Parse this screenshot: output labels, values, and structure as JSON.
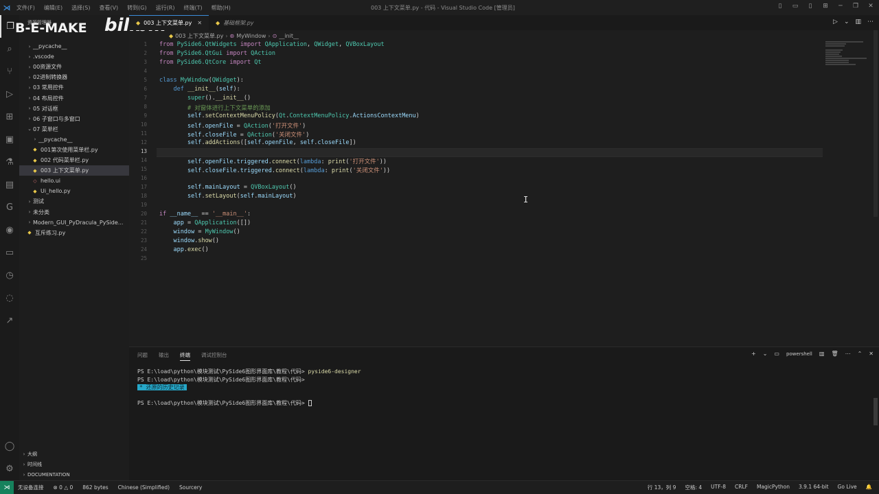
{
  "titlebar": {
    "menu": [
      "文件(F)",
      "编辑(E)",
      "选择(S)",
      "查看(V)",
      "转到(G)",
      "运行(R)",
      "终端(T)",
      "帮助(H)"
    ],
    "window_title": "003 上下文菜单.py - 代码 - Visual Studio Code [管理员]"
  },
  "watermark": {
    "text": "B-E-MAKE",
    "logo": "bilibili"
  },
  "sidebar": {
    "title": "资源管理器",
    "tree": [
      {
        "label": "__pycache__",
        "type": "folder",
        "depth": 1,
        "open": false
      },
      {
        "label": ".vscode",
        "type": "folder",
        "depth": 1,
        "open": false
      },
      {
        "label": "00资源文件",
        "type": "folder",
        "depth": 1,
        "open": false
      },
      {
        "label": "02进制转换器",
        "type": "folder",
        "depth": 1,
        "open": false
      },
      {
        "label": "03 常用控件",
        "type": "folder",
        "depth": 1,
        "open": false
      },
      {
        "label": "04 布局控件",
        "type": "folder",
        "depth": 1,
        "open": false
      },
      {
        "label": "05 对话框",
        "type": "folder",
        "depth": 1,
        "open": false
      },
      {
        "label": "06 子窗口与多窗口",
        "type": "folder",
        "depth": 1,
        "open": false
      },
      {
        "label": "07 菜单栏",
        "type": "folder",
        "depth": 1,
        "open": true
      },
      {
        "label": "__pycache__",
        "type": "folder",
        "depth": 2,
        "open": false
      },
      {
        "label": "001第次使用菜单栏.py",
        "type": "py",
        "depth": 2
      },
      {
        "label": "002 代码菜单栏.py",
        "type": "py",
        "depth": 2
      },
      {
        "label": "003 上下文菜单.py",
        "type": "py",
        "depth": 2,
        "selected": true
      },
      {
        "label": "hello.ui",
        "type": "ui",
        "depth": 2
      },
      {
        "label": "Ui_hello.py",
        "type": "py",
        "depth": 2
      },
      {
        "label": "测试",
        "type": "folder",
        "depth": 1,
        "open": false
      },
      {
        "label": "未分类",
        "type": "folder",
        "depth": 1,
        "open": false
      },
      {
        "label": "Modern_GUI_PyDracula_PySide...",
        "type": "folder",
        "depth": 1,
        "open": false
      },
      {
        "label": "互斥练习.py",
        "type": "py",
        "depth": 1
      }
    ],
    "footer": [
      "大纲",
      "时间线",
      "DOCUMENTATION"
    ]
  },
  "tabs": [
    {
      "label": "003 上下文菜单.py",
      "active": true
    },
    {
      "label": "基础框架.py",
      "active": false,
      "preview": true
    }
  ],
  "breadcrumb": [
    "003 上下文菜单.py",
    "MyWindow",
    "__init__"
  ],
  "editor": {
    "current_line": 13,
    "lines": [
      {
        "n": "1",
        "html": "<span class='k'>from</span> <span class='c'>PySide6.QtWidgets</span> <span class='k'>import</span> <span class='c'>QApplication</span>, <span class='c'>QWidget</span>, <span class='c'>QVBoxLayout</span>"
      },
      {
        "n": "2",
        "html": "<span class='k'>from</span> <span class='c'>PySide6.QtGui</span> <span class='k'>import</span> <span class='c'>QAction</span>"
      },
      {
        "n": "3",
        "html": "<span class='k'>from</span> <span class='c'>PySide6.QtCore</span> <span class='k'>import</span> <span class='c'>Qt</span>"
      },
      {
        "n": "4",
        "html": ""
      },
      {
        "n": "5",
        "html": "<span class='kb'>class</span> <span class='c'>MyWindow</span>(<span class='c'>QWidget</span>):"
      },
      {
        "n": "6",
        "html": "    <span class='kb'>def</span> <span class='f'>__init__</span>(<span class='v'>self</span>):"
      },
      {
        "n": "7",
        "html": "        <span class='c'>super</span>().<span class='f'>__init__</span>()"
      },
      {
        "n": "8",
        "html": "        <span class='cm'># 对窗体进行上下文菜单的添加</span>"
      },
      {
        "n": "9",
        "html": "        <span class='v'>self</span>.<span class='f'>setContextMenuPolicy</span>(<span class='c'>Qt</span>.<span class='c'>ContextMenuPolicy</span>.<span class='v'>ActionsContextMenu</span>)"
      },
      {
        "n": "10",
        "html": "        <span class='v'>self</span>.<span class='v'>openFile</span> = <span class='c'>QAction</span>(<span class='s'>'打开文件'</span>)"
      },
      {
        "n": "11",
        "html": "        <span class='v'>self</span>.<span class='v'>closeFile</span> = <span class='c'>QAction</span>(<span class='s'>'关闭文件'</span>)"
      },
      {
        "n": "12",
        "html": "        <span class='v'>self</span>.<span class='f'>addActions</span>([<span class='v'>self</span>.<span class='v'>openFile</span>, <span class='v'>self</span>.<span class='v'>closeFile</span>])"
      },
      {
        "n": "13",
        "html": ""
      },
      {
        "n": "14",
        "html": "        <span class='v'>self</span>.<span class='v'>openFile</span>.<span class='v'>triggered</span>.<span class='f'>connect</span>(<span class='kb'>lambda</span>: <span class='f'>print</span>(<span class='s'>'打开文件'</span>))"
      },
      {
        "n": "15",
        "html": "        <span class='v'>self</span>.<span class='v'>closeFile</span>.<span class='v'>triggered</span>.<span class='f'>connect</span>(<span class='kb'>lambda</span>: <span class='f'>print</span>(<span class='s'>'关闭文件'</span>))"
      },
      {
        "n": "16",
        "html": ""
      },
      {
        "n": "17",
        "html": "        <span class='v'>self</span>.<span class='v'>mainLayout</span> = <span class='c'>QVBoxLayout</span>()"
      },
      {
        "n": "18",
        "html": "        <span class='v'>self</span>.<span class='f'>setLayout</span>(<span class='v'>self</span>.<span class='v'>mainLayout</span>)"
      },
      {
        "n": "19",
        "html": ""
      },
      {
        "n": "20",
        "html": "<span class='k'>if</span> <span class='v'>__name__</span> == <span class='s'>'__main__'</span>:"
      },
      {
        "n": "21",
        "html": "    <span class='v'>app</span> = <span class='c'>QApplication</span>([])"
      },
      {
        "n": "22",
        "html": "    <span class='v'>window</span> = <span class='c'>MyWindow</span>()"
      },
      {
        "n": "23",
        "html": "    <span class='v'>window</span>.<span class='f'>show</span>()"
      },
      {
        "n": "24",
        "html": "    <span class='v'>app</span>.<span class='f'>exec</span>()"
      },
      {
        "n": "25",
        "html": ""
      }
    ]
  },
  "panel": {
    "tabs": [
      "问题",
      "输出",
      "终端",
      "调试控制台"
    ],
    "active_tab": "终端",
    "shell": "powershell",
    "terminal": {
      "prompt1": "PS E:\\load\\python\\模块测试\\PySide6图形界面库\\教程\\代码> ",
      "cmd1": "pyside6-designer",
      "prompt2": "PS E:\\load\\python\\模块测试\\PySide6图形界面库\\教程\\代码>",
      "history": "* 还原的历史记录",
      "prompt3": "PS E:\\load\\python\\模块测试\\PySide6图形界面库\\教程\\代码> "
    }
  },
  "statusbar": {
    "remote": "⋊",
    "left": [
      "无设备连接",
      "⊗ 0 △ 0",
      "862 bytes",
      "Chinese (Simplified)",
      "Sourcery"
    ],
    "right": [
      "行 13，列 9",
      "空格: 4",
      "UTF-8",
      "CRLF",
      "MagicPython",
      "3.9.1 64-bit",
      "Go Live"
    ]
  }
}
